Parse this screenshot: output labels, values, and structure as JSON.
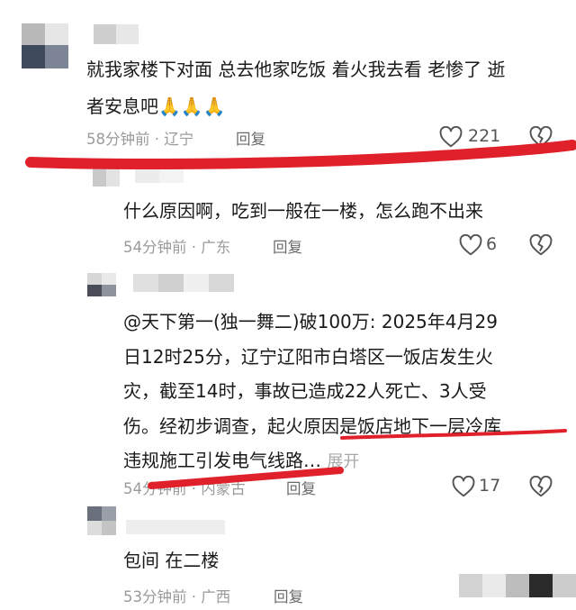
{
  "comments": [
    {
      "text_line1": "就我家楼下对面 总去他家吃饭 着火我去看 老惨了 逝",
      "text_line2": "者安息吧",
      "emoji": "🙏🙏🙏",
      "time": "58分钟前",
      "location": "辽宁",
      "reply_label": "回复",
      "likes": "221"
    },
    {
      "text": "什么原因啊，吃到一般在一楼，怎么跑不出来",
      "time": "54分钟前",
      "location": "广东",
      "reply_label": "回复",
      "likes": "6"
    },
    {
      "lines": [
        "@天下第一(独一舞二)破100万: 2025年4月29",
        "日12时25分，辽宁辽阳市白塔区一饭店发生火",
        "灾，截至14时，事故已造成22人死亡、3人受",
        "伤。经初步调查，起火原因是饭店地下一层冷库",
        "违规施工引发电气线路…"
      ],
      "expand_label": "展开",
      "time": "54分钟前",
      "location": "内蒙古",
      "reply_label": "回复",
      "likes": "17"
    },
    {
      "text": "包间 在二楼",
      "time": "53分钟前",
      "location": "广西",
      "reply_label": "回复"
    }
  ],
  "meta_separator": "·",
  "colors": {
    "annotation_red": "#e0202a",
    "meta_gray": "#9a9a9a"
  },
  "icons": [
    "heart-icon",
    "broken-heart-icon",
    "pray-emoji"
  ]
}
